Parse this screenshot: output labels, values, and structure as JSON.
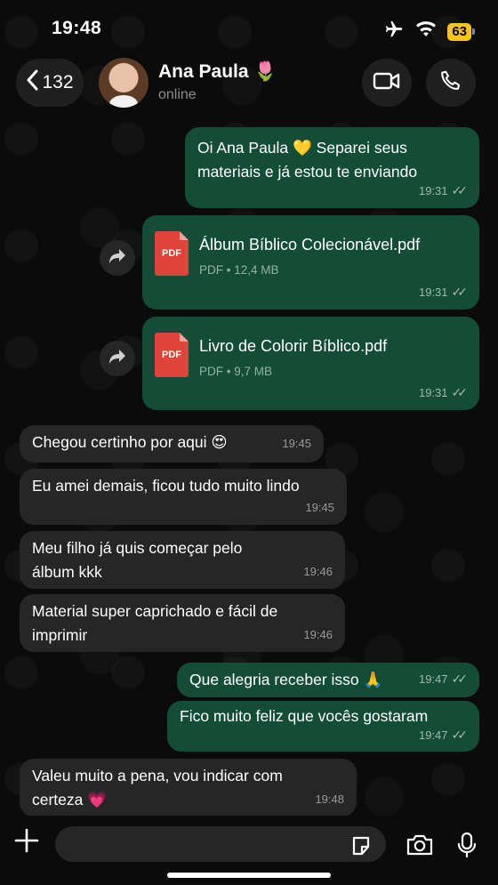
{
  "status_bar": {
    "time": "19:48",
    "battery": "63",
    "icons": [
      "airplane-icon",
      "wifi-icon",
      "battery-icon"
    ]
  },
  "header": {
    "back_count": "132",
    "contact_name": "Ana Paula 🌷",
    "contact_status": "online",
    "icons": [
      "chevron-left-icon",
      "video-call-icon",
      "phone-icon"
    ]
  },
  "messages": [
    {
      "direction": "out",
      "text": "Oi Ana Paula 💛 Separei seus materiais e já estou te enviando",
      "time": "19:31",
      "read": true
    },
    {
      "direction": "out",
      "type": "file",
      "file_name": "Álbum Bíblico Colecionável.pdf",
      "file_info": "PDF • 12,4 MB",
      "file_badge": "PDF",
      "time": "19:31",
      "read": true
    },
    {
      "direction": "out",
      "type": "file",
      "file_name": "Livro de Colorir Bíblico.pdf",
      "file_info": "PDF • 9,7 MB",
      "file_badge": "PDF",
      "time": "19:31",
      "read": true
    },
    {
      "direction": "in",
      "text": "Chegou certinho por aqui 😍",
      "time": "19:45"
    },
    {
      "direction": "in",
      "text": "Eu amei demais, ficou tudo muito lindo",
      "time": "19:45"
    },
    {
      "direction": "in",
      "text": "Meu filho já quis começar pelo álbum kkk",
      "time": "19:46"
    },
    {
      "direction": "in",
      "text": "Material super caprichado e fácil de imprimir",
      "time": "19:46"
    },
    {
      "direction": "out",
      "text": "Que alegria receber isso 🙏",
      "time": "19:47",
      "read": true
    },
    {
      "direction": "out",
      "text": "Fico muito feliz que vocês gostaram",
      "time": "19:47",
      "read": true
    },
    {
      "direction": "in",
      "text": "Valeu muito a pena, vou indicar com certeza 💗",
      "time": "19:48"
    }
  ],
  "input_bar": {
    "placeholder": "",
    "icons": [
      "plus-icon",
      "sticker-icon",
      "camera-icon",
      "microphone-icon"
    ]
  },
  "colors": {
    "background": "#0b0b0b",
    "outgoing_bubble": "#144d37",
    "incoming_bubble": "#262626",
    "pdf_icon": "#e0433a",
    "battery": "#f5c518"
  }
}
